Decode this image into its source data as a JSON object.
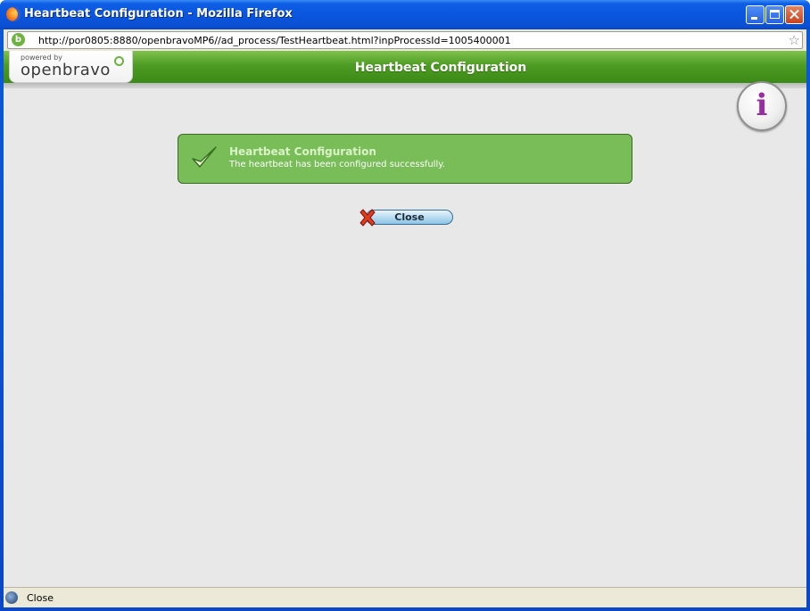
{
  "window": {
    "title": "Heartbeat Configuration - Mozilla Firefox"
  },
  "urlbar": {
    "url": "http://por0805:8880/openbravoMP6//ad_process/TestHeartbeat.html?inpProcessId=1005400001",
    "site_icon_letter": "b"
  },
  "header": {
    "powered_by": "powered by",
    "logo_text": "openbravo",
    "title": "Heartbeat Configuration",
    "info_glyph": "i"
  },
  "message": {
    "title": "Heartbeat Configuration",
    "text": "The heartbeat has been configured successfully."
  },
  "actions": {
    "close_label": "Close"
  },
  "statusbar": {
    "text": "Close"
  },
  "colors": {
    "titlebar": "#0a56de",
    "header_green": "#4d9b23",
    "message_green": "#79bd58",
    "page_bg": "#e8e8e8"
  }
}
